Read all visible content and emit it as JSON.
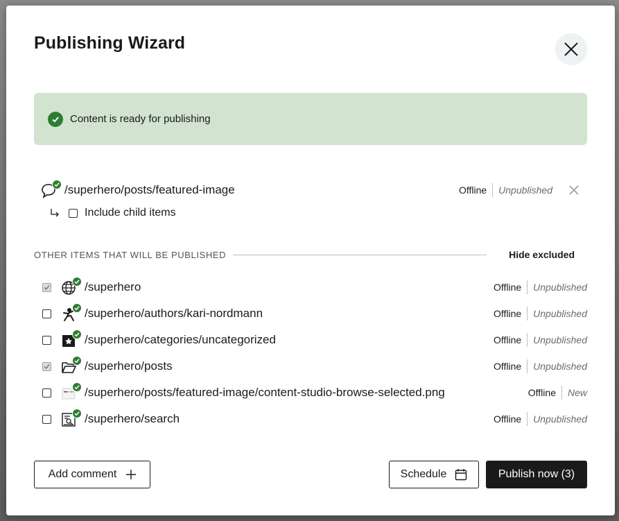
{
  "dialog": {
    "title": "Publishing Wizard",
    "banner_text": "Content is ready for publishing"
  },
  "main_item": {
    "path": "/superhero/posts/featured-image",
    "status": "Offline",
    "publish_state": "Unpublished",
    "include_children_label": "Include child items"
  },
  "dependencies": {
    "section_title": "OTHER ITEMS THAT WILL BE PUBLISHED",
    "hide_excluded_label": "Hide excluded",
    "items": [
      {
        "path": "/superhero",
        "status": "Offline",
        "publish_state": "Unpublished",
        "icon": "globe-icon",
        "checked": true
      },
      {
        "path": "/superhero/authors/kari-nordmann",
        "status": "Offline",
        "publish_state": "Unpublished",
        "icon": "author-icon",
        "checked": false
      },
      {
        "path": "/superhero/categories/uncategorized",
        "status": "Offline",
        "publish_state": "Unpublished",
        "icon": "category-icon",
        "checked": false
      },
      {
        "path": "/superhero/posts",
        "status": "Offline",
        "publish_state": "Unpublished",
        "icon": "folder-icon",
        "checked": true
      },
      {
        "path": "/superhero/posts/featured-image/content-studio-browse-selected.png",
        "status": "Offline",
        "publish_state": "New",
        "icon": "image-icon",
        "checked": false
      },
      {
        "path": "/superhero/search",
        "status": "Offline",
        "publish_state": "Unpublished",
        "icon": "search-page-icon",
        "checked": false
      }
    ]
  },
  "footer": {
    "add_comment_label": "Add comment",
    "schedule_label": "Schedule",
    "publish_label": "Publish now (3)"
  },
  "colors": {
    "banner_bg": "#d2e3d0",
    "success": "#2e7d32",
    "primary_button": "#1a1a1a"
  }
}
